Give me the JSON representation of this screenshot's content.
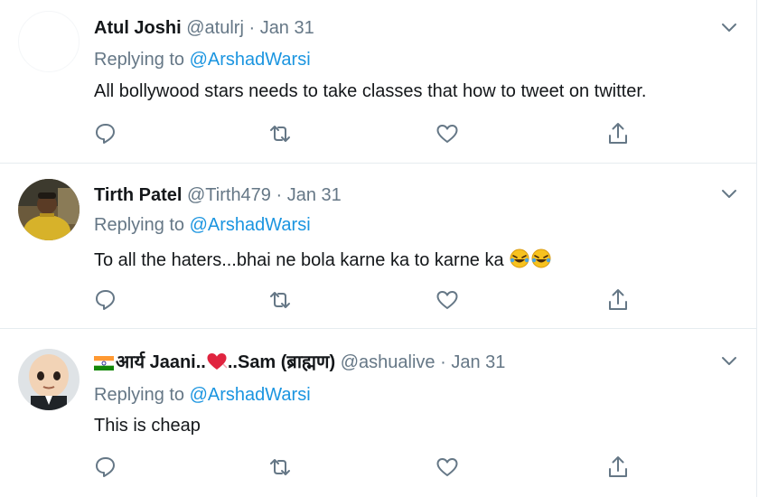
{
  "tweets": [
    {
      "name": "Atul Joshi",
      "handle": "@atulrj",
      "separator": "·",
      "date": "Jan 31",
      "replying_prefix": "Replying to",
      "replying_to": "@ArshadWarsi",
      "text": "All bollywood stars needs to take classes that how to tweet on twitter."
    },
    {
      "name": "Tirth Patel",
      "handle": "@Tirth479",
      "separator": "·",
      "date": "Jan 31",
      "replying_prefix": "Replying to",
      "replying_to": "@ArshadWarsi",
      "text": "To all the haters...bhai ne bola karne ka to karne ka"
    },
    {
      "name_part1": "आर्य Jaani..",
      "name_part2": "..Sam (ब्राह्मण)",
      "handle": "@ashualive",
      "separator": "·",
      "date": "Jan 31",
      "replying_prefix": "Replying to",
      "replying_to": "@ArshadWarsi",
      "text": "This is cheap"
    }
  ],
  "icons": {
    "reply": "reply-icon",
    "retweet": "retweet-icon",
    "like": "heart-icon",
    "share": "share-icon",
    "more": "chevron-down-icon"
  },
  "colors": {
    "text": "#14171a",
    "secondary": "#657786",
    "link": "#1b95e0",
    "divider": "#e6ecf0"
  }
}
